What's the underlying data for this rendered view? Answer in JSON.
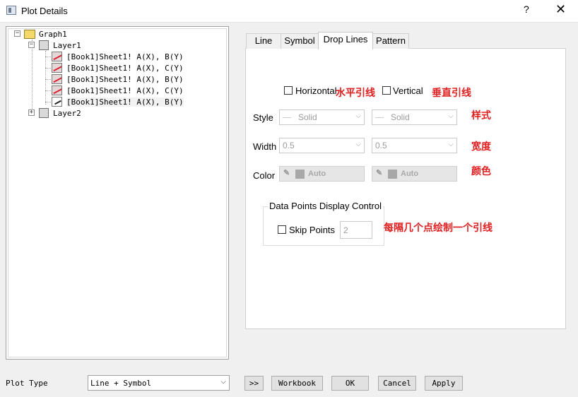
{
  "window": {
    "title": "Plot Details",
    "help": "?",
    "close": "✕"
  },
  "tree": {
    "graph": "Graph1",
    "layer1": "Layer1",
    "plots": [
      "[Book1]Sheet1! A(X), B(Y)",
      "[Book1]Sheet1! A(X), C(Y)",
      "[Book1]Sheet1! A(X), B(Y)",
      "[Book1]Sheet1! A(X), C(Y)",
      "[Book1]Sheet1! A(X), B(Y)"
    ],
    "layer2": "Layer2",
    "collapse_glyph": "−",
    "expand_glyph": "+"
  },
  "tabs": [
    "Line",
    "Symbol",
    "Drop Lines",
    "Pattern"
  ],
  "active_tab": "Drop Lines",
  "droplines": {
    "horizontal_label": "Horizontal",
    "horizontal_checked": false,
    "vertical_label": "Vertical",
    "vertical_checked": false,
    "style_label": "Style",
    "width_label": "Width",
    "color_label": "Color",
    "h_style": "Solid",
    "v_style": "Solid",
    "h_width": "0.5",
    "v_width": "0.5",
    "h_color": "Auto",
    "v_color": "Auto",
    "pen_glyph": "✎",
    "dropdown_glyph": "⌵"
  },
  "annotations": {
    "horizontal": "水平引线",
    "vertical": "垂直引线",
    "style": "样式",
    "width": "宽度",
    "color": "颜色",
    "skip": "每隔几个点绘制一个引线"
  },
  "data_points_group": {
    "title": "Data Points Display Control",
    "skip_label": "Skip Points",
    "skip_checked": false,
    "skip_value": "2"
  },
  "bottom": {
    "plot_type_label": "Plot Type",
    "plot_type_value": "Line + Symbol",
    "expand_button": ">>",
    "workbook_button": "Workbook",
    "ok_button": "OK",
    "cancel_button": "Cancel",
    "apply_button": "Apply"
  },
  "colors": {
    "annotation": "#e02020",
    "background": "#f0f0f0"
  }
}
